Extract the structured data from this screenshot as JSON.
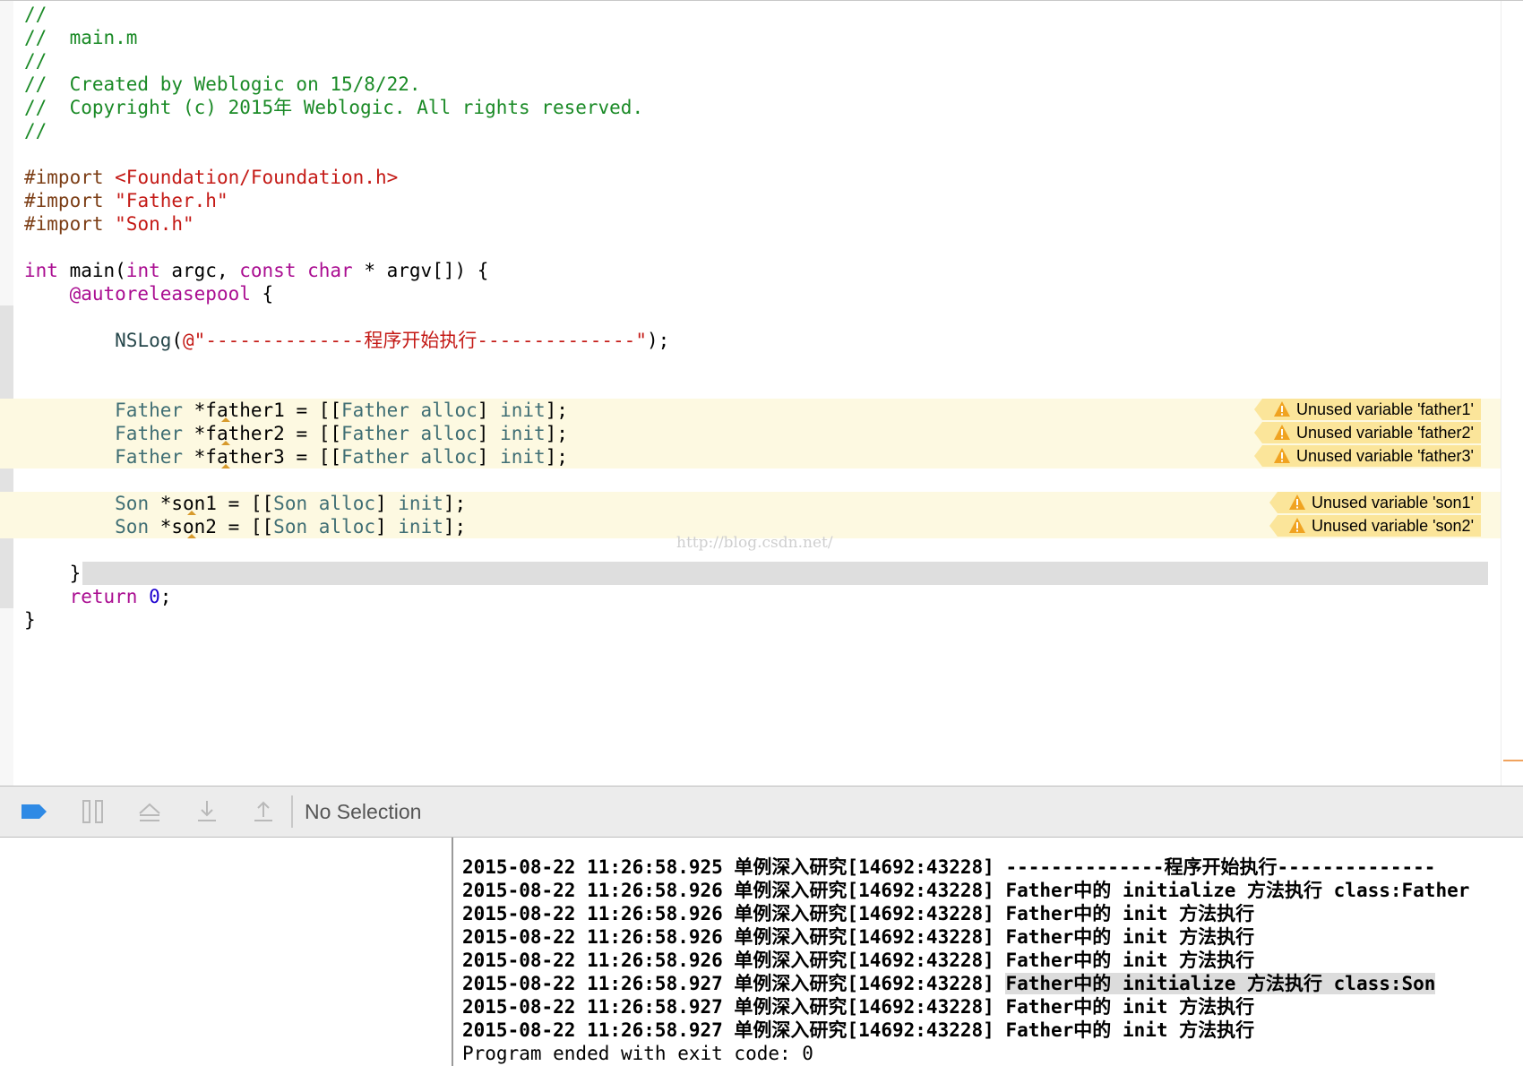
{
  "editor": {
    "lines": [
      {
        "parts": [
          {
            "t": "//",
            "c": "cm"
          }
        ]
      },
      {
        "parts": [
          {
            "t": "//  main.m",
            "c": "cm"
          }
        ]
      },
      {
        "parts": [
          {
            "t": "//",
            "c": "cm"
          }
        ]
      },
      {
        "parts": [
          {
            "t": "//  Created by Weblogic on 15/8/22.",
            "c": "cm"
          }
        ]
      },
      {
        "parts": [
          {
            "t": "//  Copyright (c) 2015年 Weblogic. All rights reserved.",
            "c": "cm"
          }
        ]
      },
      {
        "parts": [
          {
            "t": "//",
            "c": "cm"
          }
        ]
      },
      {
        "parts": []
      },
      {
        "parts": [
          {
            "t": "#import ",
            "c": "pp"
          },
          {
            "t": "<Foundation/Foundation.h>",
            "c": "str"
          }
        ]
      },
      {
        "parts": [
          {
            "t": "#import ",
            "c": "pp"
          },
          {
            "t": "\"Father.h\"",
            "c": "str"
          }
        ]
      },
      {
        "parts": [
          {
            "t": "#import ",
            "c": "pp"
          },
          {
            "t": "\"Son.h\"",
            "c": "str"
          }
        ]
      },
      {
        "parts": []
      },
      {
        "parts": [
          {
            "t": "int",
            "c": "kw"
          },
          {
            "t": " main("
          },
          {
            "t": "int",
            "c": "kw"
          },
          {
            "t": " argc, "
          },
          {
            "t": "const",
            "c": "kw"
          },
          {
            "t": " "
          },
          {
            "t": "char",
            "c": "kw"
          },
          {
            "t": " * argv[]) {"
          }
        ]
      },
      {
        "parts": [
          {
            "t": "    "
          },
          {
            "t": "@autoreleasepool",
            "c": "kw"
          },
          {
            "t": " {"
          }
        ]
      },
      {
        "parts": [],
        "band": true
      },
      {
        "parts": [
          {
            "t": "        "
          },
          {
            "t": "NSLog",
            "c": "fn"
          },
          {
            "t": "("
          },
          {
            "t": "@\"--------------程序开始执行--------------\"",
            "c": "str"
          },
          {
            "t": ");"
          }
        ],
        "band": true
      },
      {
        "parts": [],
        "band": true
      },
      {
        "parts": [],
        "band": true
      },
      {
        "parts": [
          {
            "t": "        "
          },
          {
            "t": "Father",
            "c": "ty"
          },
          {
            "t": " *father1 = [["
          },
          {
            "t": "Father",
            "c": "ty"
          },
          {
            "t": " "
          },
          {
            "t": "alloc",
            "c": "ty"
          },
          {
            "t": "] "
          },
          {
            "t": "init",
            "c": "ty"
          },
          {
            "t": "];"
          }
        ],
        "warn": "Unused variable 'father1'",
        "caret": 1
      },
      {
        "parts": [
          {
            "t": "        "
          },
          {
            "t": "Father",
            "c": "ty"
          },
          {
            "t": " *father2 = [["
          },
          {
            "t": "Father",
            "c": "ty"
          },
          {
            "t": " "
          },
          {
            "t": "alloc",
            "c": "ty"
          },
          {
            "t": "] "
          },
          {
            "t": "init",
            "c": "ty"
          },
          {
            "t": "];"
          }
        ],
        "warn": "Unused variable 'father2'",
        "caret": 1
      },
      {
        "parts": [
          {
            "t": "        "
          },
          {
            "t": "Father",
            "c": "ty"
          },
          {
            "t": " *father3 = [["
          },
          {
            "t": "Father",
            "c": "ty"
          },
          {
            "t": " "
          },
          {
            "t": "alloc",
            "c": "ty"
          },
          {
            "t": "] "
          },
          {
            "t": "init",
            "c": "ty"
          },
          {
            "t": "];"
          }
        ],
        "warn": "Unused variable 'father3'",
        "caret": 1
      },
      {
        "parts": [],
        "band": true
      },
      {
        "parts": [
          {
            "t": "        "
          },
          {
            "t": "Son",
            "c": "ty"
          },
          {
            "t": " *son1 = [["
          },
          {
            "t": "Son",
            "c": "ty"
          },
          {
            "t": " "
          },
          {
            "t": "alloc",
            "c": "ty"
          },
          {
            "t": "] "
          },
          {
            "t": "init",
            "c": "ty"
          },
          {
            "t": "];"
          }
        ],
        "warn": "Unused variable 'son1'",
        "caret": 2
      },
      {
        "parts": [
          {
            "t": "        "
          },
          {
            "t": "Son",
            "c": "ty"
          },
          {
            "t": " *son2 = [["
          },
          {
            "t": "Son",
            "c": "ty"
          },
          {
            "t": " "
          },
          {
            "t": "alloc",
            "c": "ty"
          },
          {
            "t": "] "
          },
          {
            "t": "init",
            "c": "ty"
          },
          {
            "t": "];"
          }
        ],
        "warn": "Unused variable 'son2'",
        "caret": 2
      },
      {
        "parts": [],
        "band": true
      },
      {
        "parts": [
          {
            "t": "    }"
          }
        ],
        "cursor": true,
        "band": true
      },
      {
        "parts": [
          {
            "t": "    "
          },
          {
            "t": "return",
            "c": "kw"
          },
          {
            "t": " "
          },
          {
            "t": "0",
            "c": "num"
          },
          {
            "t": ";"
          }
        ],
        "band": true
      },
      {
        "parts": [
          {
            "t": "}"
          }
        ]
      }
    ],
    "watermark": "http://blog.csdn.net/"
  },
  "debugbar": {
    "buttons": [
      {
        "name": "breakpoints-toggle-button",
        "icon": "breakpoint-icon"
      },
      {
        "name": "pause-button",
        "icon": "pause-icon"
      },
      {
        "name": "step-over-button",
        "icon": "step-over-icon"
      },
      {
        "name": "step-into-button",
        "icon": "step-into-icon"
      },
      {
        "name": "step-out-button",
        "icon": "step-out-icon"
      }
    ],
    "selection_label": "No Selection"
  },
  "console": {
    "lines": [
      {
        "prefix": "2015-08-22 11:26:58.925 单例深入研究[14692:43228] ",
        "msg": "--------------程序开始执行--------------"
      },
      {
        "prefix": "2015-08-22 11:26:58.926 单例深入研究[14692:43228] ",
        "msg": "Father中的 initialize 方法执行 class:Father"
      },
      {
        "prefix": "2015-08-22 11:26:58.926 单例深入研究[14692:43228] ",
        "msg": "Father中的 init 方法执行"
      },
      {
        "prefix": "2015-08-22 11:26:58.926 单例深入研究[14692:43228] ",
        "msg": "Father中的 init 方法执行"
      },
      {
        "prefix": "2015-08-22 11:26:58.926 单例深入研究[14692:43228] ",
        "msg": "Father中的 init 方法执行"
      },
      {
        "prefix": "2015-08-22 11:26:58.927 单例深入研究[14692:43228] ",
        "msg": "Father中的 initialize 方法执行 class:Son",
        "highlight": true
      },
      {
        "prefix": "2015-08-22 11:26:58.927 单例深入研究[14692:43228] ",
        "msg": "Father中的 init 方法执行"
      },
      {
        "prefix": "2015-08-22 11:26:58.927 单例深入研究[14692:43228] ",
        "msg": "Father中的 init 方法执行"
      },
      {
        "prefix": "",
        "msg": "Program ended with exit code: 0",
        "plain": true
      }
    ]
  },
  "colors": {
    "comment": "#1a8a26",
    "keyword": "#aa0d91",
    "string": "#c41a16",
    "preprocessor": "#7c3e16",
    "warning_badge": "#fbe59a",
    "warning_line": "#fdf9e1"
  }
}
